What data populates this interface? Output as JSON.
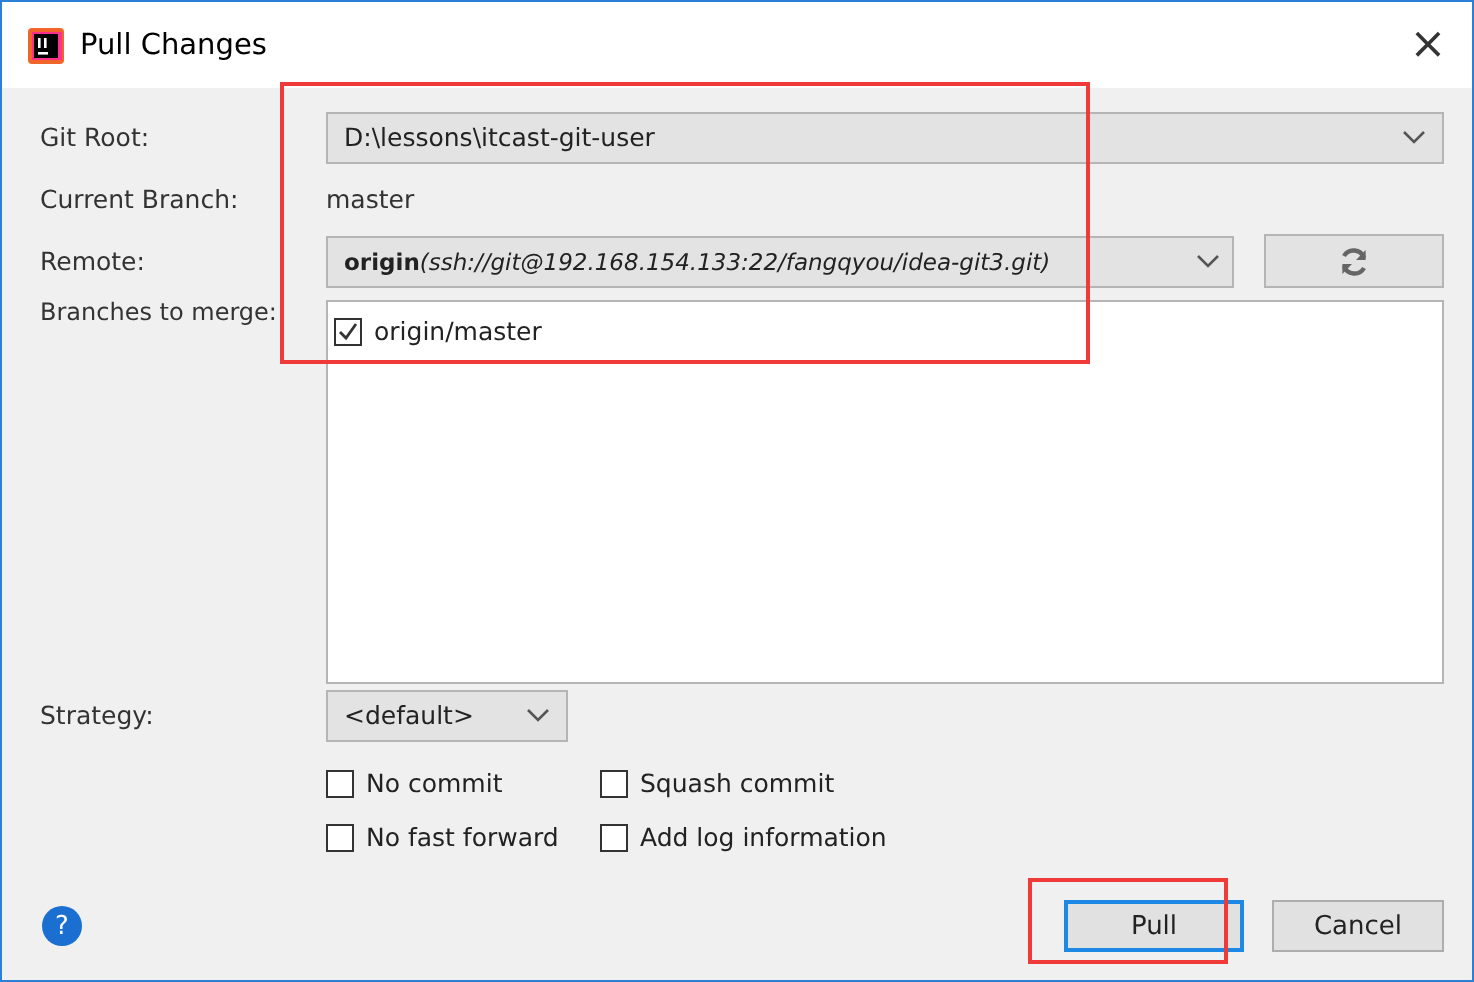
{
  "window": {
    "title": "Pull Changes",
    "close": "×"
  },
  "git_root": {
    "label": "Git Root:",
    "value": "D:\\lessons\\itcast-git-user"
  },
  "current_branch": {
    "label": "Current Branch:",
    "value": "master"
  },
  "remote": {
    "label": "Remote:",
    "name": "origin",
    "url": "(ssh://git@192.168.154.133:22/fangqyou/idea-git3.git)"
  },
  "branches": {
    "label": "Branches to merge:",
    "items": [
      {
        "label": "origin/master",
        "checked": true
      }
    ]
  },
  "strategy": {
    "label": "Strategy:",
    "value": "<default>"
  },
  "options": [
    {
      "label": "No commit",
      "checked": false
    },
    {
      "label": "Squash commit",
      "checked": false
    },
    {
      "label": "No fast forward",
      "checked": false
    },
    {
      "label": "Add log information",
      "checked": false
    }
  ],
  "help": "?",
  "buttons": [
    {
      "label": "Pull",
      "selected": true
    },
    {
      "label": "Cancel",
      "selected": false
    }
  ],
  "annotations": [
    {
      "kind": "highlight-box"
    },
    {
      "kind": "highlight-box"
    }
  ]
}
